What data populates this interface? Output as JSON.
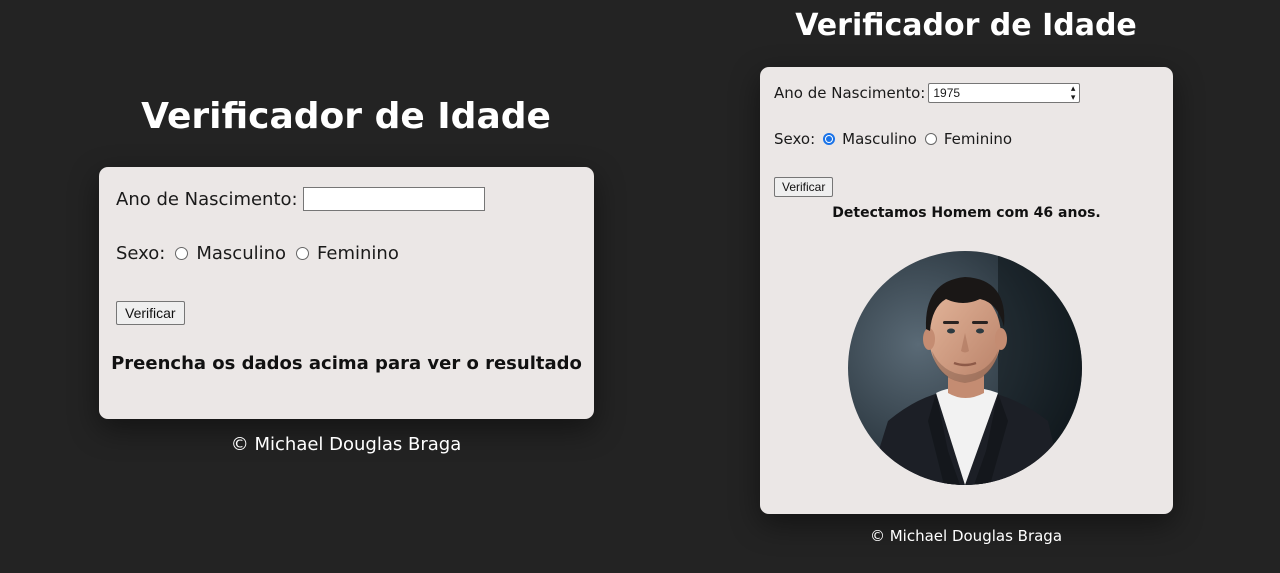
{
  "left": {
    "title": "Verificador de Idade",
    "year_label": "Ano de Nascimento:",
    "year_value": "",
    "sex_label": "Sexo:",
    "option_male": "Masculino",
    "option_female": "Feminino",
    "selected_sex": "",
    "button_label": "Verificar",
    "result": "Preencha os dados acima para ver o resultado",
    "footer": "© Michael Douglas Braga"
  },
  "right": {
    "title": "Verificador de Idade",
    "year_label": "Ano de Nascimento:",
    "year_value": "1975",
    "sex_label": "Sexo:",
    "option_male": "Masculino",
    "option_female": "Feminino",
    "selected_sex": "Masculino",
    "button_label": "Verificar",
    "result": "Detectamos Homem com 46 anos.",
    "footer": "© Michael Douglas Braga",
    "photo": "portrait of a man in a dark suit and white shirt"
  },
  "colors": {
    "background": "#232323",
    "card": "#ebe7e6",
    "accent": "#1a73e8"
  }
}
